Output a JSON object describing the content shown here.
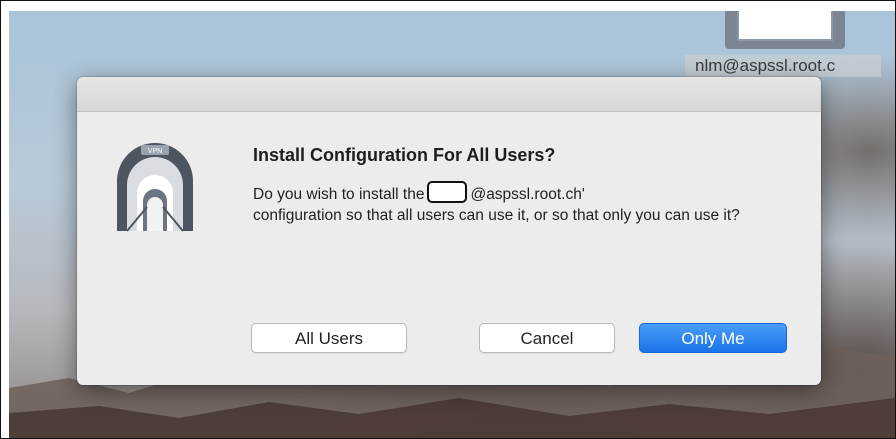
{
  "desktop": {
    "icon_label": "nlm@aspssl.root.c"
  },
  "dialog": {
    "icon": "vpn-tunnel-icon",
    "icon_badge": "VPN",
    "title": "Install Configuration For All Users?",
    "message_part1": "Do you wish to install the",
    "message_part2": "@aspssl.root.ch'",
    "message_part3": "configuration so that all users can use it, or so that only you can use it?",
    "buttons": {
      "all_users": "All Users",
      "cancel": "Cancel",
      "only_me": "Only Me"
    }
  },
  "colors": {
    "primary_button": "#1a73e8",
    "dialog_background": "#ececec"
  }
}
